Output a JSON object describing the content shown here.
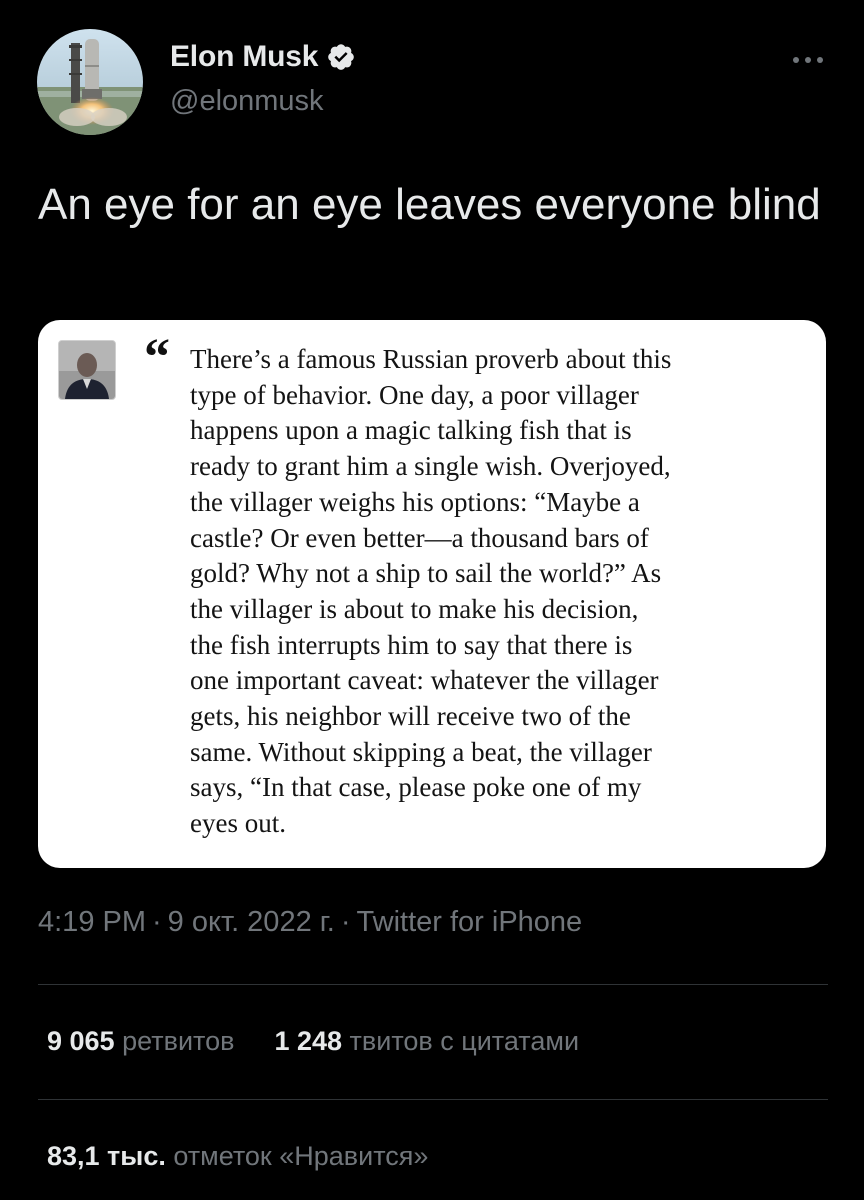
{
  "author": {
    "name": "Elon Musk",
    "handle": "@elonmusk",
    "verified": true
  },
  "tweet": {
    "text": "An eye for an eye leaves everyone blind"
  },
  "quote_card": {
    "quote_mark": "“",
    "text_lines": [
      "There’s a famous Russian proverb about this",
      "type of behavior. One day, a poor villager",
      "happens upon a magic talking fish that is",
      "ready to grant him a single wish. Overjoyed,",
      "the villager weighs his options: “Maybe a",
      "castle? Or even better—a thousand bars of",
      "gold? Why not a ship to sail the world?” As",
      "the villager is about to make his decision,",
      "the fish interrupts him to say that there is",
      "one important caveat: whatever the villager",
      "gets, his neighbor will receive two of the",
      "same. Without skipping a beat, the villager",
      "says, “In that case, please poke one of my",
      "eyes out."
    ]
  },
  "meta": {
    "time": "4:19 PM",
    "date": "9 окт. 2022 г.",
    "source": "Twitter for iPhone",
    "separator": "·"
  },
  "stats": {
    "retweets_count": "9 065",
    "retweets_label": "ретвитов",
    "quotes_count": "1 248",
    "quotes_label": "твитов с цитатами",
    "likes_count": "83,1 тыс.",
    "likes_label": "отметок «Нравится»"
  },
  "colors": {
    "background": "#000000",
    "primary_text": "#e7e9ea",
    "secondary_text": "#71767b",
    "divider": "#2f3336",
    "verified_badge": "#e7e9ea",
    "card_background": "#ffffff"
  },
  "icons": {
    "verified": "verified-badge-icon",
    "more": "more-horizontal-icon"
  }
}
